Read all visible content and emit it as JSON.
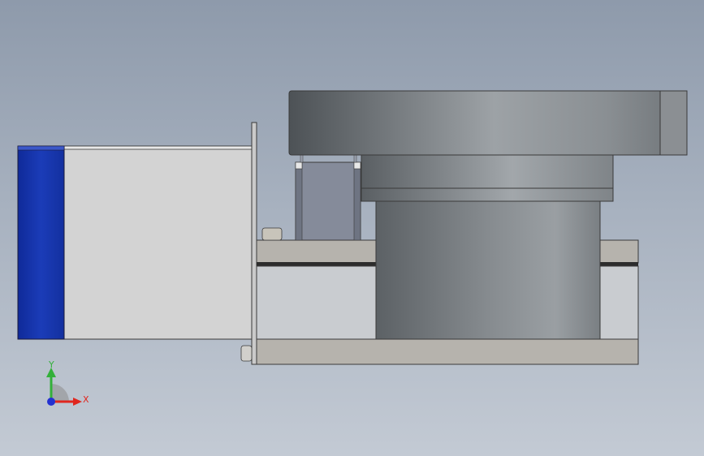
{
  "viewport": {
    "background_top": "#8e9aab",
    "background_bottom": "#c3cad4"
  },
  "model": {
    "motor_cap_color": "#1533a8",
    "motor_body_color": "#d2d2d2",
    "flange_color": "#c8c8c8",
    "base_plate_color": "#b4b1ab",
    "gearbox_block_color": "#848a99",
    "cylinder_dark": "#52575c",
    "cylinder_light": "#9ca1a5",
    "housing_block_color": "#c9cccf"
  },
  "triad": {
    "x_label": "X",
    "y_label": "Y",
    "x_color": "#e0261e",
    "y_color": "#33b03a",
    "z_color": "#2431d1",
    "icons": [
      "axis-triad-icon"
    ]
  }
}
